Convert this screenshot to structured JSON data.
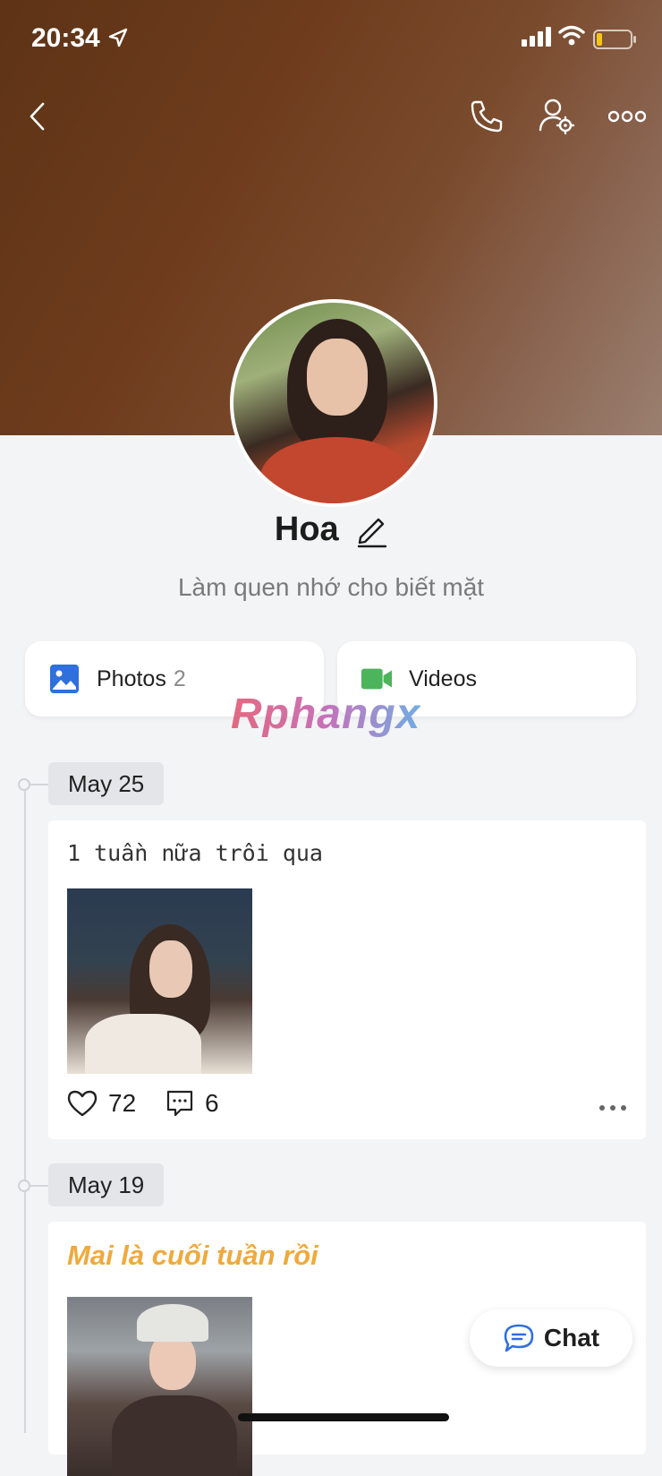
{
  "status_bar": {
    "time": "20:34"
  },
  "profile": {
    "name": "Hoa",
    "bio": "Làm quen nhớ cho biết mặt"
  },
  "media": {
    "photos_label": "Photos",
    "photos_count": "2",
    "videos_label": "Videos"
  },
  "watermark": "Rphangx",
  "posts": [
    {
      "date": "May 25",
      "text": "1 tuần nữa trôi qua",
      "likes": "72",
      "comments": "6"
    },
    {
      "date": "May 19",
      "text": "Mai là cuối tuần rồi"
    }
  ],
  "chat_button": {
    "label": "Chat"
  },
  "colors": {
    "accent_blue": "#2f6fde",
    "video_green": "#4cb45a",
    "styled_text": "#f0a93b",
    "background": "#f3f4f6"
  }
}
